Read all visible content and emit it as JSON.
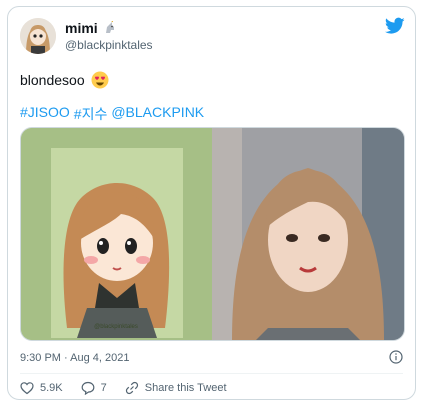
{
  "author": {
    "display_name": "mimi",
    "handle": "@blackpinktales",
    "badge_icon": "unicorn-emoji",
    "avatar_icon": "cartoon-avatar"
  },
  "tweet": {
    "text": "blondesoo",
    "emoji": "heart-eyes-emoji",
    "hashtags": [
      "#JISOO",
      "#지수",
      "@BLACKPINK"
    ],
    "timestamp": "9:30 PM · Aug 4, 2021"
  },
  "media": {
    "left_caption": "@blackpinktales",
    "left_icon": "cartoon-illustration",
    "right_icon": "portrait-photo"
  },
  "actions": {
    "like_count": "5.9K",
    "reply_count": "7",
    "share_label": "Share this Tweet"
  },
  "colors": {
    "link": "#1d9bf0",
    "text": "#0f1419",
    "muted": "#536471",
    "like": "#f91880"
  }
}
